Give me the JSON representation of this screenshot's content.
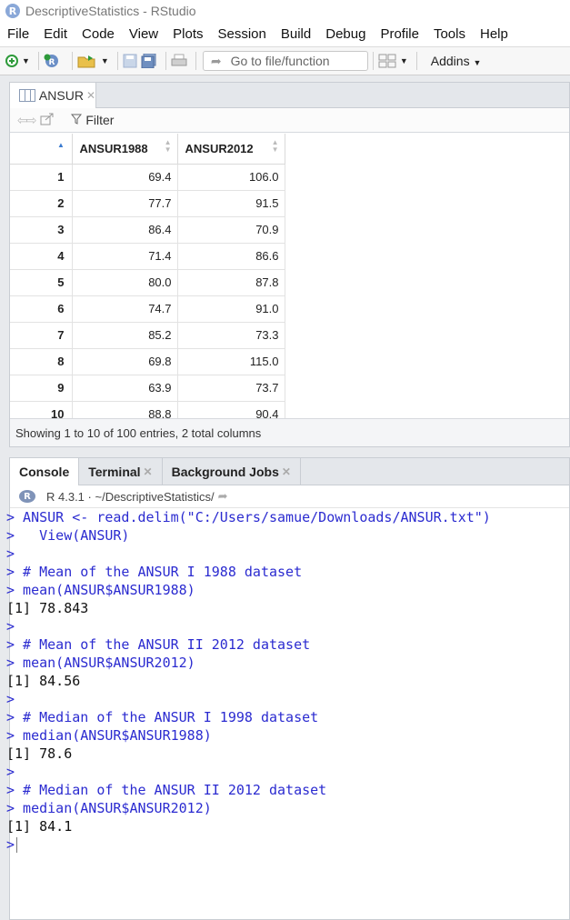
{
  "window": {
    "title": "DescriptiveStatistics - RStudio",
    "logo_letter": "R"
  },
  "menu": [
    "File",
    "Edit",
    "Code",
    "View",
    "Plots",
    "Session",
    "Build",
    "Debug",
    "Profile",
    "Tools",
    "Help"
  ],
  "toolbar": {
    "goto_placeholder": "Go to file/function",
    "addins_label": "Addins"
  },
  "viewer": {
    "tab_label": "ANSUR",
    "filter_label": "Filter",
    "columns": [
      "ANSUR1988",
      "ANSUR2012"
    ],
    "rows": [
      {
        "idx": "1",
        "a": "69.4",
        "b": "106.0"
      },
      {
        "idx": "2",
        "a": "77.7",
        "b": "91.5"
      },
      {
        "idx": "3",
        "a": "86.4",
        "b": "70.9"
      },
      {
        "idx": "4",
        "a": "71.4",
        "b": "86.6"
      },
      {
        "idx": "5",
        "a": "80.0",
        "b": "87.8"
      },
      {
        "idx": "6",
        "a": "74.7",
        "b": "91.0"
      },
      {
        "idx": "7",
        "a": "85.2",
        "b": "73.3"
      },
      {
        "idx": "8",
        "a": "69.8",
        "b": "115.0"
      },
      {
        "idx": "9",
        "a": "63.9",
        "b": "73.7"
      },
      {
        "idx": "10",
        "a": "88.8",
        "b": "90.4"
      }
    ],
    "footer": "Showing 1 to 10 of 100 entries, 2 total columns"
  },
  "console": {
    "tabs": [
      "Console",
      "Terminal",
      "Background Jobs"
    ],
    "r_version": "R 4.3.1",
    "path": "~/DescriptiveStatistics/",
    "lines": [
      {
        "type": "in",
        "text": "> ANSUR <- read.delim(\"C:/Users/samue/Downloads/ANSUR.txt\")"
      },
      {
        "type": "in",
        "text": ">   View(ANSUR)"
      },
      {
        "type": "in",
        "text": ">"
      },
      {
        "type": "in",
        "text": "> # Mean of the ANSUR I 1988 dataset"
      },
      {
        "type": "in",
        "text": "> mean(ANSUR$ANSUR1988)"
      },
      {
        "type": "out",
        "text": "[1] 78.843"
      },
      {
        "type": "in",
        "text": ">"
      },
      {
        "type": "in",
        "text": "> # Mean of the ANSUR II 2012 dataset"
      },
      {
        "type": "in",
        "text": "> mean(ANSUR$ANSUR2012)"
      },
      {
        "type": "out",
        "text": "[1] 84.56"
      },
      {
        "type": "in",
        "text": ">"
      },
      {
        "type": "in",
        "text": "> # Median of the ANSUR I 1998 dataset"
      },
      {
        "type": "in",
        "text": "> median(ANSUR$ANSUR1988)"
      },
      {
        "type": "out",
        "text": "[1] 78.6"
      },
      {
        "type": "in",
        "text": ">"
      },
      {
        "type": "in",
        "text": "> # Median of the ANSUR II 2012 dataset"
      },
      {
        "type": "in",
        "text": "> median(ANSUR$ANSUR2012)"
      },
      {
        "type": "out",
        "text": "[1] 84.1"
      }
    ],
    "prompt": ">"
  }
}
